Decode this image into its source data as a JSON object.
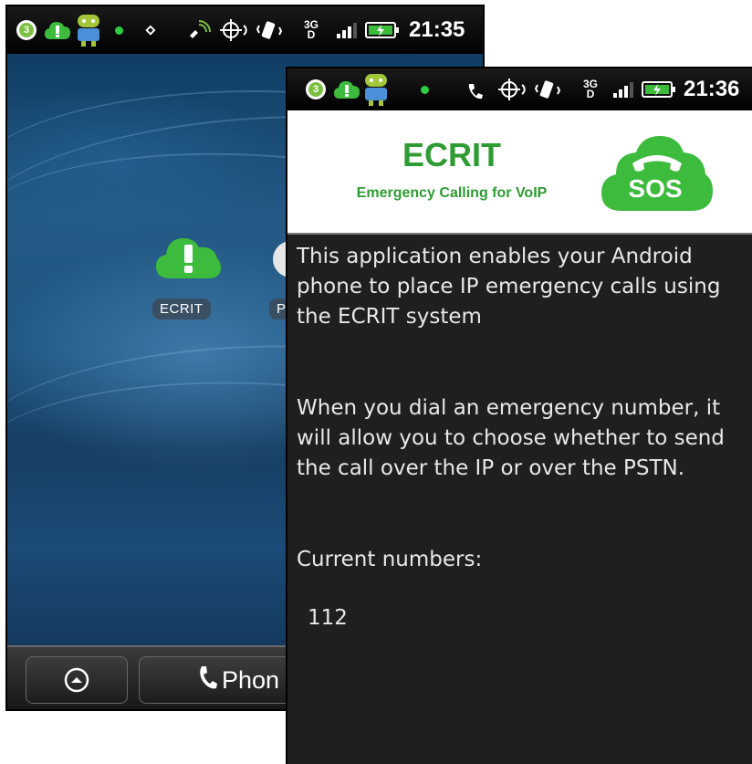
{
  "back_screen": {
    "status_bar": {
      "time": "21:35",
      "notification_count": "3",
      "network_type": "3G",
      "network_subtype": "D"
    },
    "home_icons": [
      {
        "label": "ECRIT"
      },
      {
        "label": "P"
      }
    ],
    "dock": {
      "phone_label": "Phon"
    }
  },
  "front_screen": {
    "status_bar": {
      "time": "21:36",
      "notification_count": "3",
      "network_type": "3G",
      "network_subtype": "D"
    },
    "header": {
      "title": "ECRIT",
      "subtitle": "Emergency Calling for VoIP",
      "logo_text": "SOS"
    },
    "body": {
      "intro": "This application enables your Android phone to place IP emergency calls using the ECRIT system",
      "dial_info": "When you dial an emergency number, it will allow you to choose whether to send the call over the IP or over the PSTN.",
      "numbers_label": "Current numbers:",
      "numbers": [
        "112"
      ]
    }
  },
  "colors": {
    "brand_green": "#2e9c32",
    "app_background": "#1f1f1f",
    "icon_green": "#3cbb3c"
  }
}
